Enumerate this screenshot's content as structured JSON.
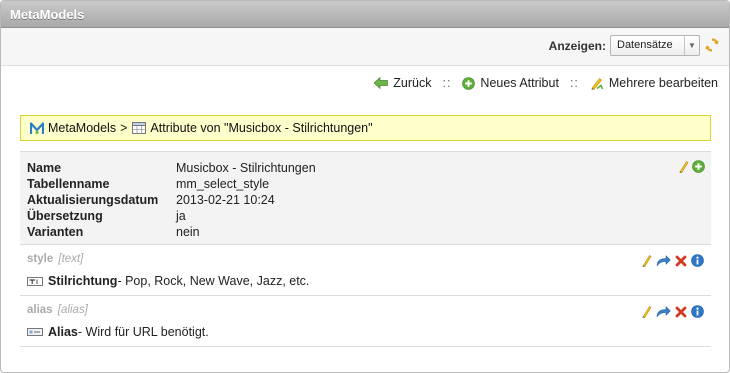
{
  "window": {
    "title": "MetaModels"
  },
  "filter": {
    "label": "Anzeigen:",
    "selected": "Datensätze",
    "reload_icon": "reload-icon"
  },
  "actions": {
    "back": "Zurück",
    "new_attribute": "Neues Attribut",
    "edit_multiple": "Mehrere bearbeiten",
    "separator": "::"
  },
  "breadcrumb": {
    "root": "MetaModels",
    "separator": ">",
    "current": "Attribute von \"Musicbox - Stilrichtungen\""
  },
  "meta": {
    "rows": [
      {
        "key": "Name",
        "value": "Musicbox - Stilrichtungen"
      },
      {
        "key": "Tabellenname",
        "value": "mm_select_style"
      },
      {
        "key": "Aktualisierungsdatum",
        "value": "2013-02-21 10:24"
      },
      {
        "key": "Übersetzung",
        "value": "ja"
      },
      {
        "key": "Varianten",
        "value": "nein"
      }
    ]
  },
  "attributes": [
    {
      "colname": "style",
      "type": "[text]",
      "name": "Stilrichtung",
      "description": " - Pop, Rock, New Wave, Jazz, etc.",
      "icon": "text-field-icon"
    },
    {
      "colname": "alias",
      "type": "[alias]",
      "name": "Alias",
      "description": " - Wird für URL benötigt.",
      "icon": "alias-field-icon"
    }
  ],
  "colors": {
    "titlebar": "#b2b2b2",
    "highlight_bg": "#ffffcc",
    "highlight_border": "#d5d531"
  }
}
